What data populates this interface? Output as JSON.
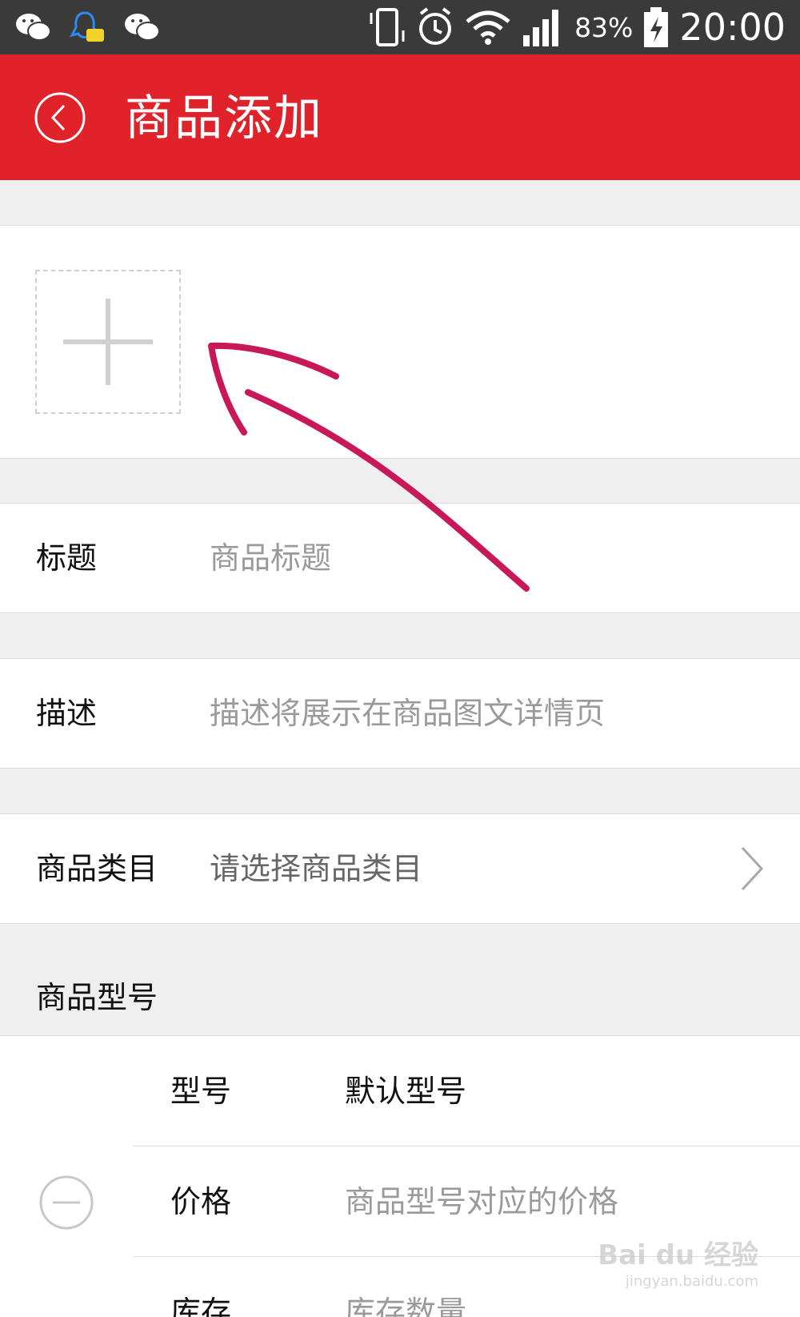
{
  "status_bar": {
    "battery_percent": "83%",
    "time": "20:00",
    "icons": [
      "wechat-icon",
      "qq-icon",
      "wechat-icon",
      "vibrate-icon",
      "alarm-icon",
      "wifi-icon",
      "signal-icon",
      "battery-charging-icon"
    ]
  },
  "app_bar": {
    "title": "商品添加",
    "back_icon": "back-circle-icon",
    "color": "#e0222a"
  },
  "image_upload": {
    "icon": "plus-icon"
  },
  "form": {
    "title": {
      "label": "标题",
      "placeholder": "商品标题"
    },
    "description": {
      "label": "描述",
      "placeholder": "描述将展示在商品图文详情页"
    },
    "category": {
      "label": "商品类目",
      "placeholder": "请选择商品类目",
      "icon": "chevron-right-icon"
    }
  },
  "variants": {
    "section_title": "商品型号",
    "model": {
      "label": "型号",
      "value": "默认型号"
    },
    "price": {
      "label": "价格",
      "placeholder": "商品型号对应的价格"
    },
    "stock": {
      "label": "库存",
      "placeholder": "库存数量"
    },
    "remove_icon": "minus-circle-icon"
  },
  "watermark": {
    "text": "Bai du 经验",
    "sub": "jingyan.baidu.com"
  },
  "annotation": {
    "icon": "arrow-icon",
    "color": "#c8185a"
  }
}
